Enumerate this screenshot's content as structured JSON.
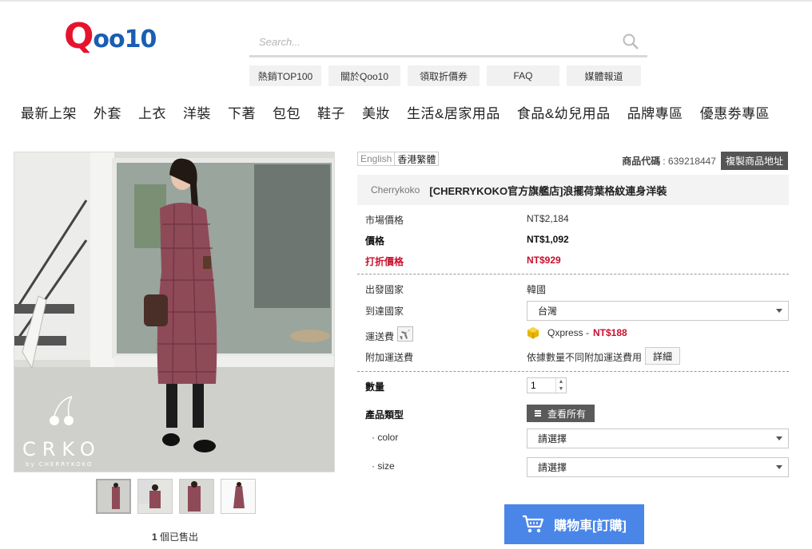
{
  "logo": {
    "first": "Q",
    "rest": "oo10"
  },
  "search": {
    "placeholder": "Search..."
  },
  "quick_links": [
    "熱銷TOP100",
    "關於Qoo10",
    "領取折價券",
    "FAQ",
    "媒體報道"
  ],
  "categories": [
    "最新上架",
    "外套",
    "上衣",
    "洋裝",
    "下著",
    "包包",
    "鞋子",
    "美妝",
    "生活&居家用品",
    "食品&幼兒用品",
    "品牌專區",
    "優惠劵專區"
  ],
  "gallery": {
    "watermark": "CRKO",
    "watermark_sub": "by CHERRYKOKO",
    "thumb_count": 4
  },
  "sold": {
    "count": "1",
    "label": "個已售出"
  },
  "lang": {
    "english": "English",
    "traditional": "香港繁體"
  },
  "product_code": {
    "label": "商品代碼",
    "value": ": 639218447",
    "copy_label": "複製商品地址"
  },
  "title": {
    "brand": "Cherrykoko",
    "name": "[CHERRYKOKO官方旗艦店]浪擺荷葉格紋連身洋裝"
  },
  "prices": {
    "market_label": "市場價格",
    "market_value": "NT$2,184",
    "price_label": "價格",
    "price_value": "NT$1,092",
    "discount_label": "打折價格",
    "discount_value": "NT$929"
  },
  "shipping": {
    "origin_label": "出發國家",
    "origin_value": "韓國",
    "dest_label": "到達國家",
    "dest_value": "台灣",
    "fee_label": "運送費",
    "carrier": "Qxpress -",
    "fee_value": "NT$188",
    "extra_label": "附加運送費",
    "extra_value": "依據數量不同附加運送費用",
    "detail_label": "詳細"
  },
  "order": {
    "qty_label": "數量",
    "qty_value": "1",
    "type_label": "產品類型",
    "view_all": "查看所有",
    "color_label": "· color",
    "color_value": "請選擇",
    "size_label": "· size",
    "size_value": "請選擇"
  },
  "cart": {
    "label": "購物車[訂購]"
  },
  "colors": {
    "accent_red": "#c8102e",
    "cart_blue": "#4a86e8",
    "logo_red": "#e5132d",
    "logo_blue": "#1a5db3"
  },
  "icons": [
    "search-icon",
    "airplane-icon",
    "package-icon",
    "cart-icon",
    "menu-icon"
  ]
}
